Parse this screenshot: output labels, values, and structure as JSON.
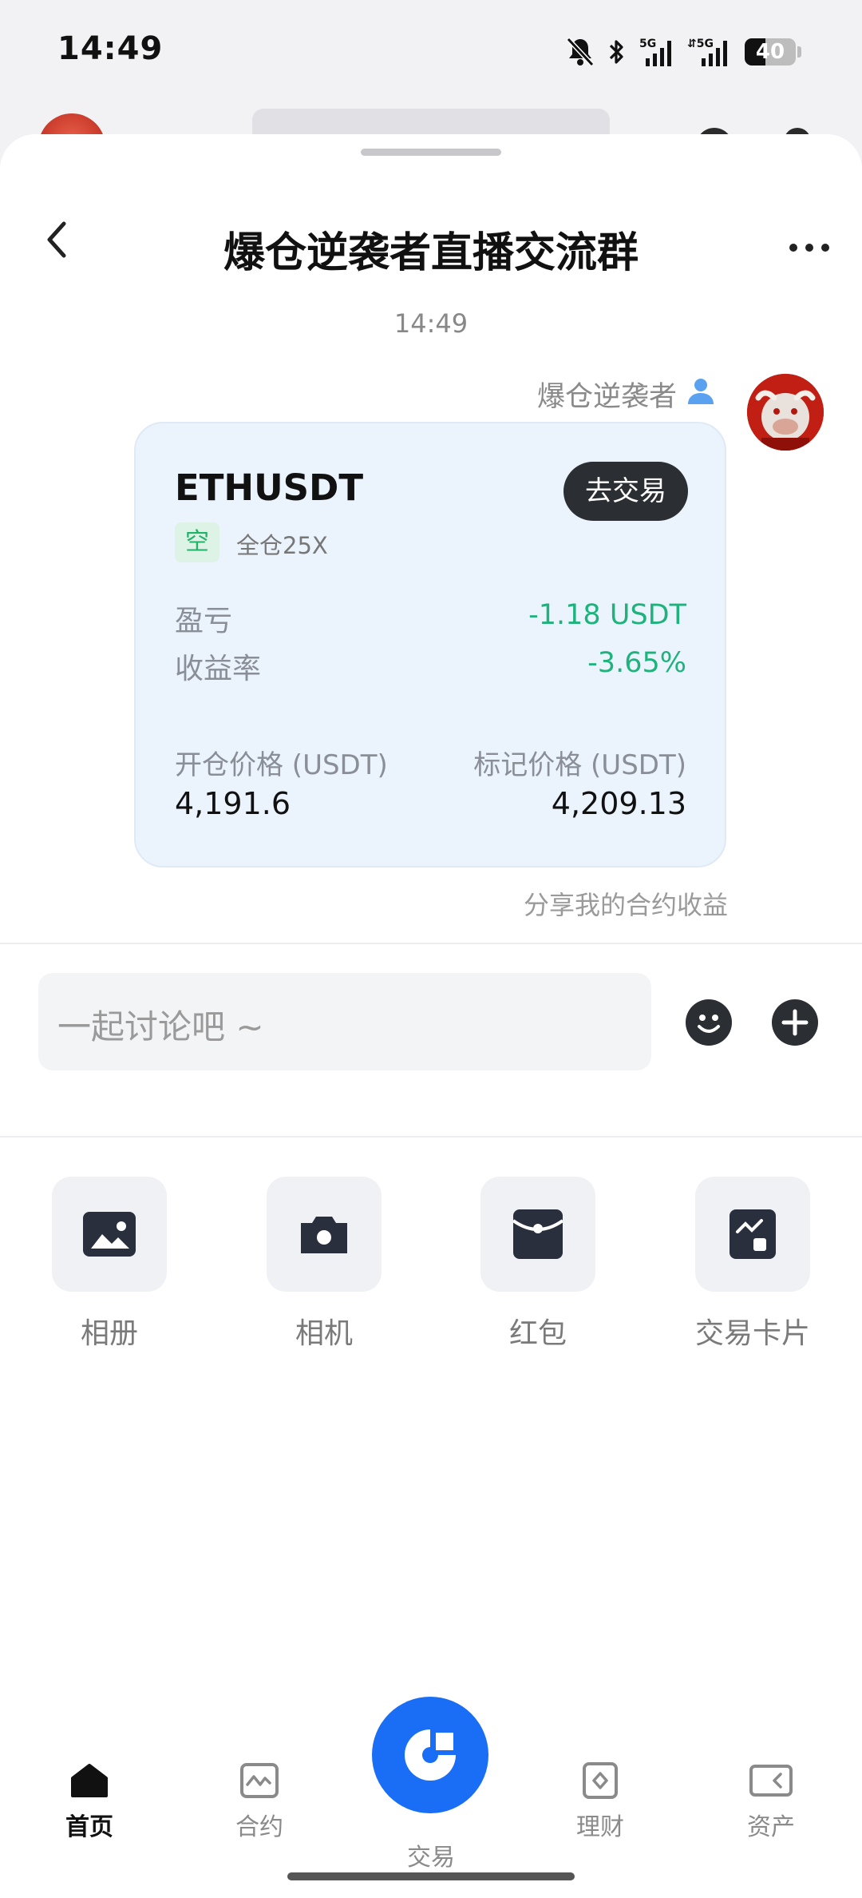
{
  "status": {
    "time": "14:49",
    "battery": "40",
    "battery_level": 0.4
  },
  "chat": {
    "title": "爆仓逆袭者直播交流群",
    "timestamp": "14:49"
  },
  "message": {
    "sender": "爆仓逆袭者",
    "card": {
      "symbol": "ETHUSDT",
      "trade_button": "去交易",
      "side": "空",
      "margin_mode": "全仓25X",
      "pnl_label": "盈亏",
      "pnl_value": "-1.18 USDT",
      "roi_label": "收益率",
      "roi_value": "-3.65%",
      "entry_label": "开仓价格 (USDT)",
      "entry_value": "4,191.6",
      "mark_label": "标记价格 (USDT)",
      "mark_value": "4,209.13"
    },
    "share_text": "分享我的合约收益"
  },
  "input": {
    "placeholder": "一起讨论吧 ~"
  },
  "tools": [
    {
      "label": "相册",
      "icon": "photo-icon"
    },
    {
      "label": "相机",
      "icon": "camera-icon"
    },
    {
      "label": "红包",
      "icon": "red-packet-icon"
    },
    {
      "label": "交易卡片",
      "icon": "trade-card-icon"
    }
  ],
  "nav": [
    {
      "label": "首页",
      "icon": "home-icon",
      "active": true
    },
    {
      "label": "合约",
      "icon": "contract-icon"
    },
    {
      "label": "交易",
      "icon": "trade-icon"
    },
    {
      "label": "理财",
      "icon": "finance-icon"
    },
    {
      "label": "资产",
      "icon": "wallet-icon"
    }
  ],
  "colors": {
    "accent": "#1a6df5",
    "positive_text": "#1fb27c",
    "card_bg": "#ebf3fd",
    "dark_button": "#2b2e33"
  }
}
